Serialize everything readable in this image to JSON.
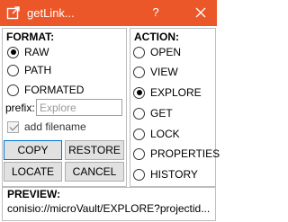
{
  "titlebar": {
    "title": "getLink...",
    "help_label": "?",
    "accent": "#ec5729"
  },
  "format": {
    "heading": "FORMAT:",
    "options": [
      {
        "label": "RAW",
        "selected": true
      },
      {
        "label": "PATH",
        "selected": false
      },
      {
        "label": "FORMATED",
        "selected": false
      }
    ],
    "prefix_label": "prefix:",
    "prefix_placeholder": "Explore",
    "prefix_value": "",
    "add_filename_label": "add filename",
    "add_filename_checked": true
  },
  "action": {
    "heading": "ACTION:",
    "options": [
      {
        "label": "OPEN",
        "selected": false
      },
      {
        "label": "VIEW",
        "selected": false
      },
      {
        "label": "EXPLORE",
        "selected": true
      },
      {
        "label": "GET",
        "selected": false
      },
      {
        "label": "LOCK",
        "selected": false
      },
      {
        "label": "PROPERTIES",
        "selected": false
      },
      {
        "label": "HISTORY",
        "selected": false
      }
    ]
  },
  "buttons": {
    "copy": "COPY",
    "restore": "RESTORE",
    "locate": "LOCATE",
    "cancel": "CANCEL"
  },
  "preview": {
    "heading": "PREVIEW:",
    "text": "conisio://microVault/EXPLORE?projectid..."
  },
  "icons": {
    "app": "external-link-icon",
    "close": "close-icon"
  }
}
